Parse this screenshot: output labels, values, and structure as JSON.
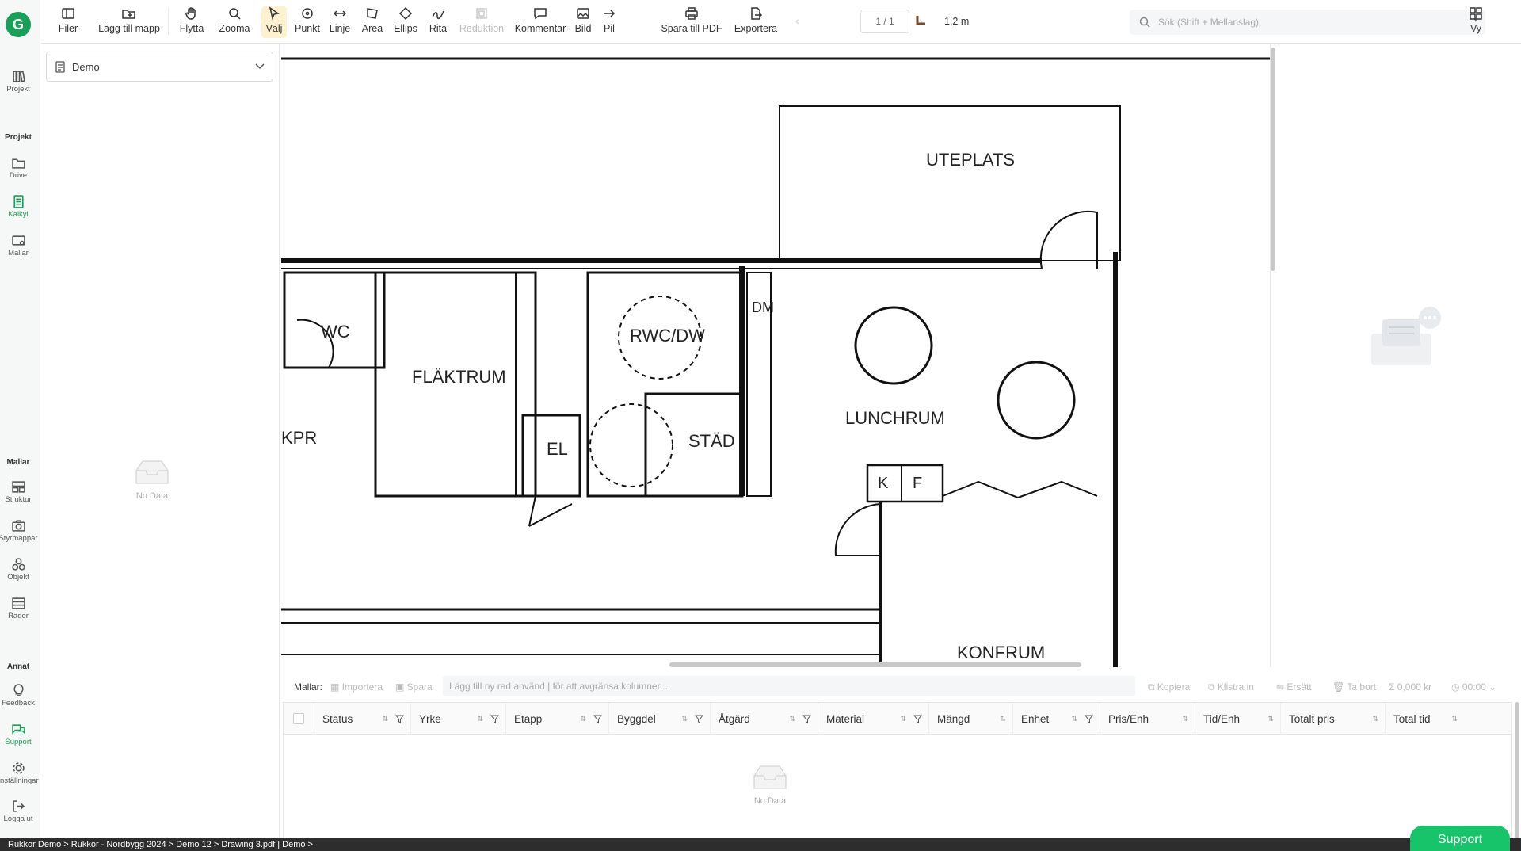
{
  "nav": {
    "logo": "G",
    "items": [
      {
        "label": "Projekt",
        "icon": "books-icon"
      },
      {
        "label": "Drive",
        "icon": "folder-icon"
      },
      {
        "label": "Kalkyl",
        "icon": "calculator-icon"
      },
      {
        "label": "Mallar",
        "icon": "template-icon"
      },
      {
        "label": "Struktur",
        "icon": "structure-icon"
      },
      {
        "label": "Styrmappar",
        "icon": "camera-icon"
      },
      {
        "label": "Objekt",
        "icon": "objects-icon"
      },
      {
        "label": "Rader",
        "icon": "rows-icon"
      },
      {
        "label": "Feedback",
        "icon": "bulb-icon"
      },
      {
        "label": "Support",
        "icon": "chat-icon"
      },
      {
        "label": "Inställningar",
        "icon": "gear-icon"
      },
      {
        "label": "Logga ut",
        "icon": "logout-icon"
      }
    ],
    "sections": {
      "projekt": "Projekt",
      "mallar": "Mallar",
      "annat": "Annat"
    },
    "active_color": "#18a058"
  },
  "toolbar": {
    "filer": "Filer",
    "lagg_till_mapp": "Lägg till mapp",
    "flytta": "Flytta",
    "zooma": "Zooma",
    "valj": "Välj",
    "punkt": "Punkt",
    "linje": "Linje",
    "area": "Area",
    "ellips": "Ellips",
    "rita": "Rita",
    "reduktion": "Reduktion",
    "kommentar": "Kommentar",
    "bild": "Bild",
    "pil": "Pil",
    "spara_pdf": "Spara till PDF",
    "exportera": "Exportera",
    "page": "1 / 1",
    "scale": "1,2 m",
    "search_placeholder": "Sök (Shift + Mellanslag)",
    "vy": "Vy"
  },
  "left_panel": {
    "selected": "Demo",
    "empty_text": "No Data"
  },
  "drawing": {
    "rooms": [
      "UTEPLATS",
      "WC",
      "FLÄKTRUM",
      "RWC/DW",
      "DM",
      "LUNCHRUM",
      "KPR",
      "EL",
      "STÄD",
      "K",
      "F",
      "KONFRUM"
    ]
  },
  "bottom": {
    "mallar_label": "Mallar:",
    "importera": "Importera",
    "spara": "Spara",
    "new_row_placeholder": "Lägg till ny rad använd | för att avgränsa kolumner...",
    "kopiera": "Kopiera",
    "klistra_in": "Klistra in",
    "ersatt": "Ersätt",
    "ta_bort": "Ta bort",
    "sum_price": "0,000 kr",
    "sum_time": "00:00"
  },
  "table": {
    "columns": [
      "Status",
      "Yrke",
      "Etapp",
      "Byggdel",
      "Åtgärd",
      "Material",
      "Mängd",
      "Enhet",
      "Pris/Enh",
      "Tid/Enh",
      "Totalt pris",
      "Total tid"
    ],
    "empty_text": "No Data"
  },
  "statusbar": {
    "path": "Rukkor Demo > Rukkor - Nordbygg 2024 > Demo 12 > Drawing 3.pdf  |  Demo >"
  },
  "support_button": "Support"
}
